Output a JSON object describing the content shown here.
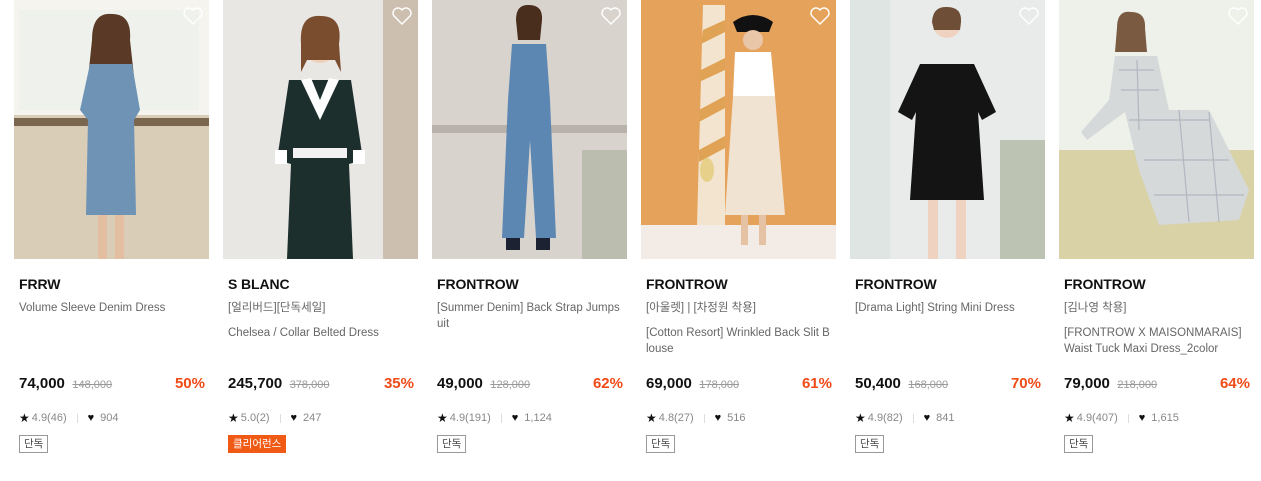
{
  "colors": {
    "discount": "#f04a16",
    "badge_orange": "#f05a15"
  },
  "products": [
    {
      "brand": "FRRW",
      "names": [
        "Volume Sleeve Denim Dress"
      ],
      "price": "74,000",
      "original": "148,000",
      "rate": "50%",
      "rating": "4.9(46)",
      "likes": "904",
      "badge": "단독",
      "badge_style": "outline",
      "photo": "denim-dress-model-kitchen",
      "dress_color": "#6e93b5",
      "bg_color": "#e3dcd0"
    },
    {
      "brand": "S BLANC",
      "names": [
        "[얼리버드][단독세일]",
        "Chelsea / Collar Belted Dress"
      ],
      "price": "245,700",
      "original": "378,000",
      "rate": "35%",
      "rating": "5.0(2)",
      "likes": "247",
      "badge": "클리어런스",
      "badge_style": "orange",
      "photo": "navy-collar-dress-model",
      "dress_color": "#1c2f2c",
      "bg_color": "#e9e7e4"
    },
    {
      "brand": "FRONTROW",
      "names": [
        "[Summer Denim] Back Strap Jumpsuit"
      ],
      "price": "49,000",
      "original": "128,000",
      "rate": "62%",
      "rating": "4.9(191)",
      "likes": "1,124",
      "badge": "단독",
      "badge_style": "outline",
      "photo": "denim-jumpsuit-model",
      "dress_color": "#5c87b3",
      "bg_color": "#d8d3cd"
    },
    {
      "brand": "FRONTROW",
      "names": [
        "[아울렛] | [차정원 착용]",
        "[Cotton Resort] Wrinkled Back Slit Blouse"
      ],
      "price": "69,000",
      "original": "178,000",
      "rate": "61%",
      "rating": "4.8(27)",
      "likes": "516",
      "badge": "단독",
      "badge_style": "outline",
      "photo": "blouse-model-orange-wall",
      "dress_color": "#f1e3d2",
      "bg_color": "#e5a25a"
    },
    {
      "brand": "FRONTROW",
      "names": [
        "[Drama Light] String Mini Dress"
      ],
      "price": "50,400",
      "original": "168,000",
      "rate": "70%",
      "rating": "4.9(82)",
      "likes": "841",
      "badge": "단독",
      "badge_style": "outline",
      "photo": "black-mini-dress-model",
      "dress_color": "#141414",
      "bg_color": "#e8ebe9"
    },
    {
      "brand": "FRONTROW",
      "names": [
        "[김나영 착용]",
        "[FRONTROW X MAISONMARAIS] Waist Tuck Maxi Dress_2color"
      ],
      "price": "79,000",
      "original": "218,000",
      "rate": "64%",
      "rating": "4.9(407)",
      "likes": "1,615",
      "badge": "단독",
      "badge_style": "outline",
      "photo": "plaid-maxi-dress-model",
      "dress_color": "#d6d9d9",
      "bg_color": "#eef0ea"
    }
  ]
}
